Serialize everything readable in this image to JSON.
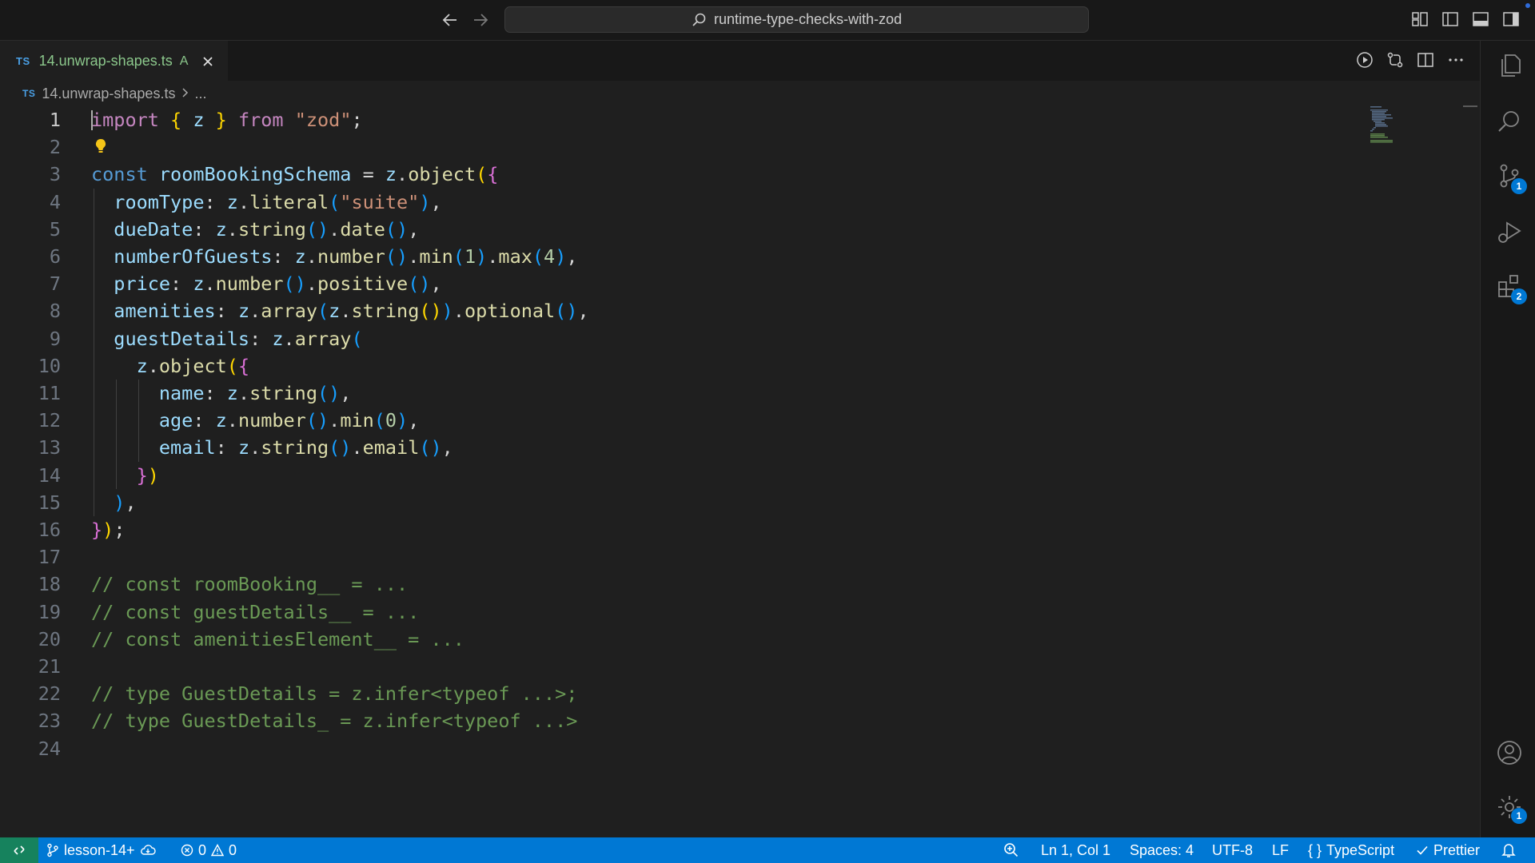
{
  "titlebar": {
    "search_text": "runtime-type-checks-with-zod"
  },
  "tabs": [
    {
      "lang_badge": "TS",
      "name": "14.unwrap-shapes.ts",
      "status": "A"
    }
  ],
  "breadcrumb": {
    "lang_badge": "TS",
    "file": "14.unwrap-shapes.ts",
    "rest": "..."
  },
  "editor": {
    "line_numbers": [
      "1",
      "2",
      "3",
      "4",
      "5",
      "6",
      "7",
      "8",
      "9",
      "10",
      "11",
      "12",
      "13",
      "14",
      "15",
      "16",
      "17",
      "18",
      "19",
      "20",
      "21",
      "22",
      "23",
      "24"
    ],
    "lines": [
      "import { z } from \"zod\";",
      "",
      "const roomBookingSchema = z.object({",
      "  roomType: z.literal(\"suite\"),",
      "  dueDate: z.string().date(),",
      "  numberOfGuests: z.number().min(1).max(4),",
      "  price: z.number().positive(),",
      "  amenities: z.array(z.string()).optional(),",
      "  guestDetails: z.array(",
      "    z.object({",
      "      name: z.string(),",
      "      age: z.number().min(0),",
      "      email: z.string().email(),",
      "    })",
      "  ),",
      "});",
      "",
      "// const roomBooking__ = ...",
      "// const guestDetails__ = ...",
      "// const amenitiesElement__ = ...",
      "",
      "// type GuestDetails = z.infer<typeof ...>;",
      "// type GuestDetails_ = z.infer<typeof ...>",
      ""
    ]
  },
  "activitybar": {
    "source_control_badge": "1",
    "extensions_badge": "2",
    "settings_badge": "1"
  },
  "statusbar": {
    "branch": "lesson-14+",
    "errors": "0",
    "warnings": "0",
    "cursor_position": "Ln 1, Col 1",
    "indentation": "Spaces: 4",
    "encoding": "UTF-8",
    "eol": "LF",
    "language": "TypeScript",
    "formatter": "Prettier"
  },
  "colors": {
    "accent": "#0078d4",
    "remote": "#16825d",
    "editor_bg": "#1f1f1f"
  }
}
